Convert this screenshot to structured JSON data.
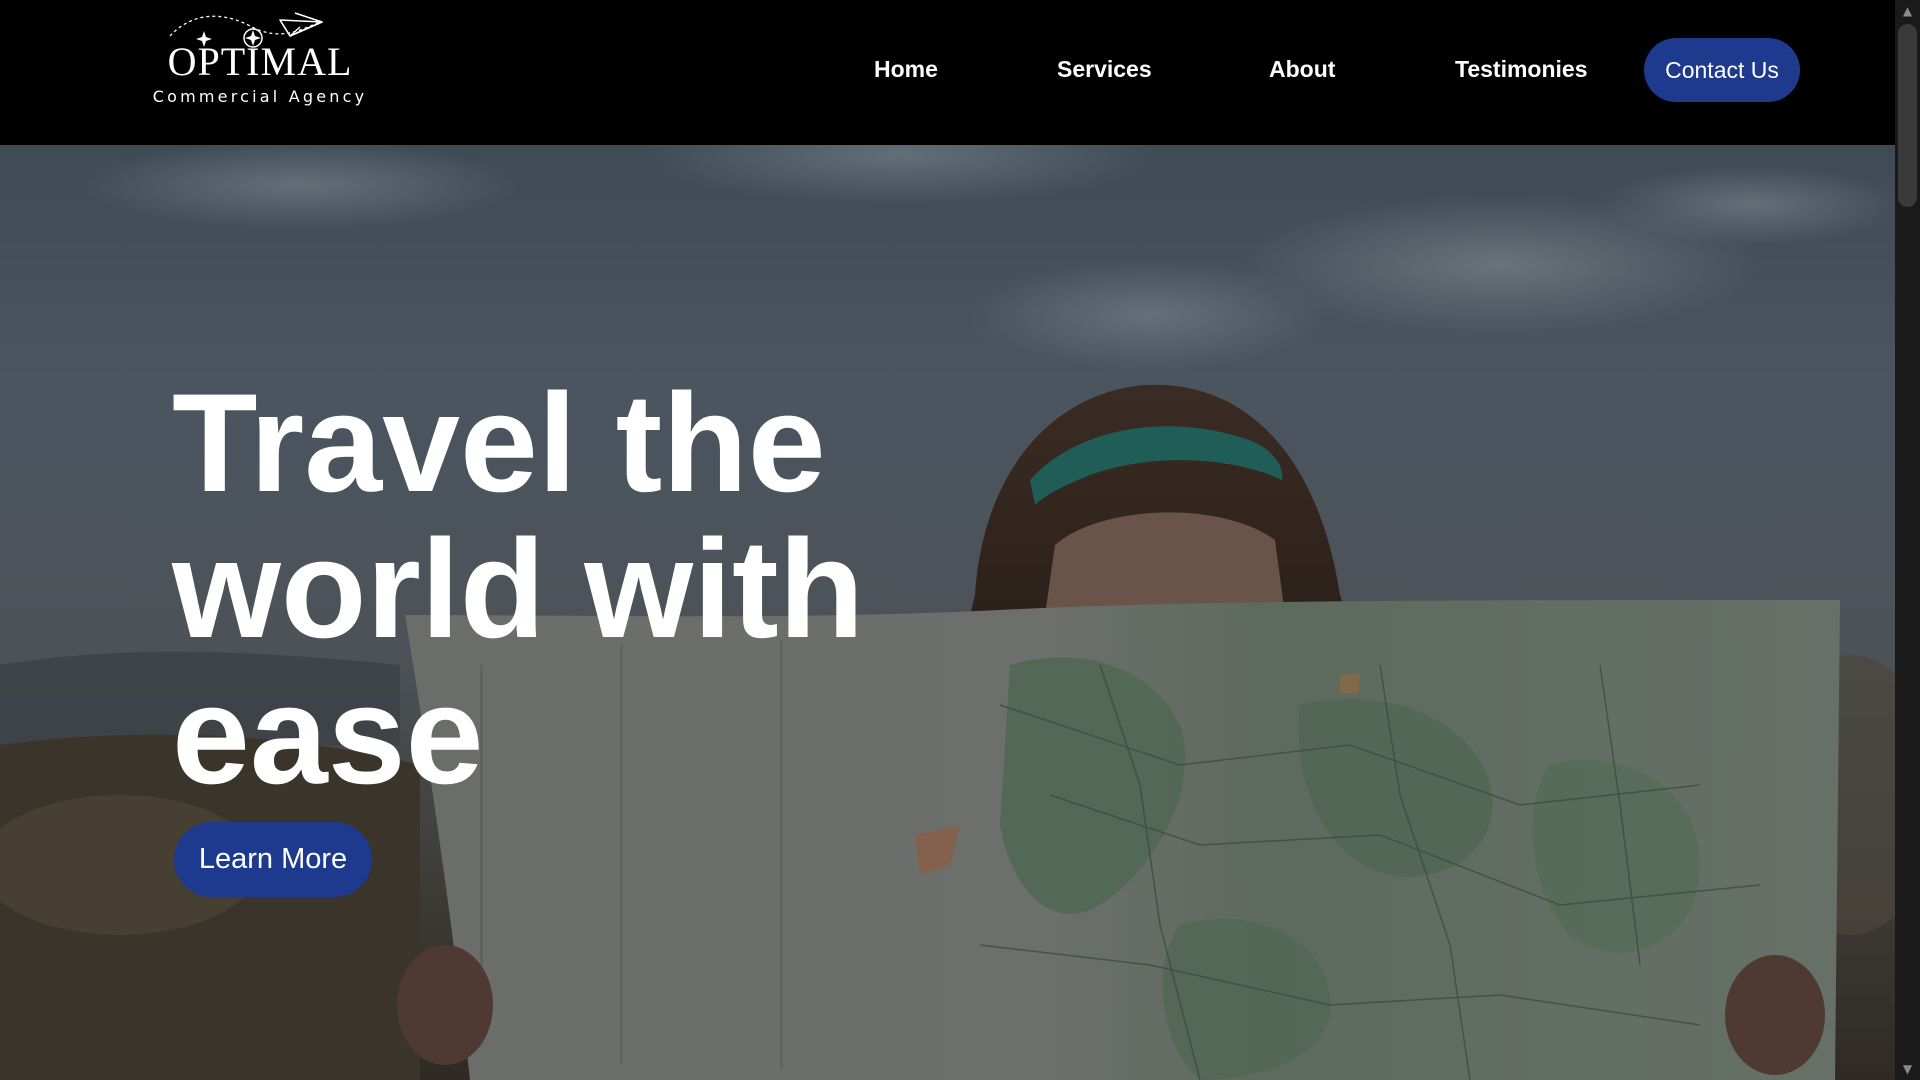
{
  "brand": {
    "name": "OPTIMAL",
    "tagline": "Commercial Agency"
  },
  "nav": {
    "items": [
      {
        "label": "Home"
      },
      {
        "label": "Services"
      },
      {
        "label": "About"
      },
      {
        "label": "Testimonies"
      }
    ],
    "contact_label": "Contact Us"
  },
  "hero": {
    "title_lines": [
      "Travel the",
      "world with",
      "ease"
    ],
    "cta_label": "Learn More",
    "image_alt": "woman-holding-map-photo"
  },
  "colors": {
    "header_bg": "#000000",
    "button_bg": "#1e3a8f",
    "text": "#ffffff"
  },
  "icons": {
    "logo": "paper-plane-sparkles-icon",
    "scroll_up": "scroll-up-arrow-icon",
    "scroll_down": "scroll-down-arrow-icon"
  },
  "scrollbar": {
    "up_glyph": "▲",
    "down_glyph": "▼"
  }
}
